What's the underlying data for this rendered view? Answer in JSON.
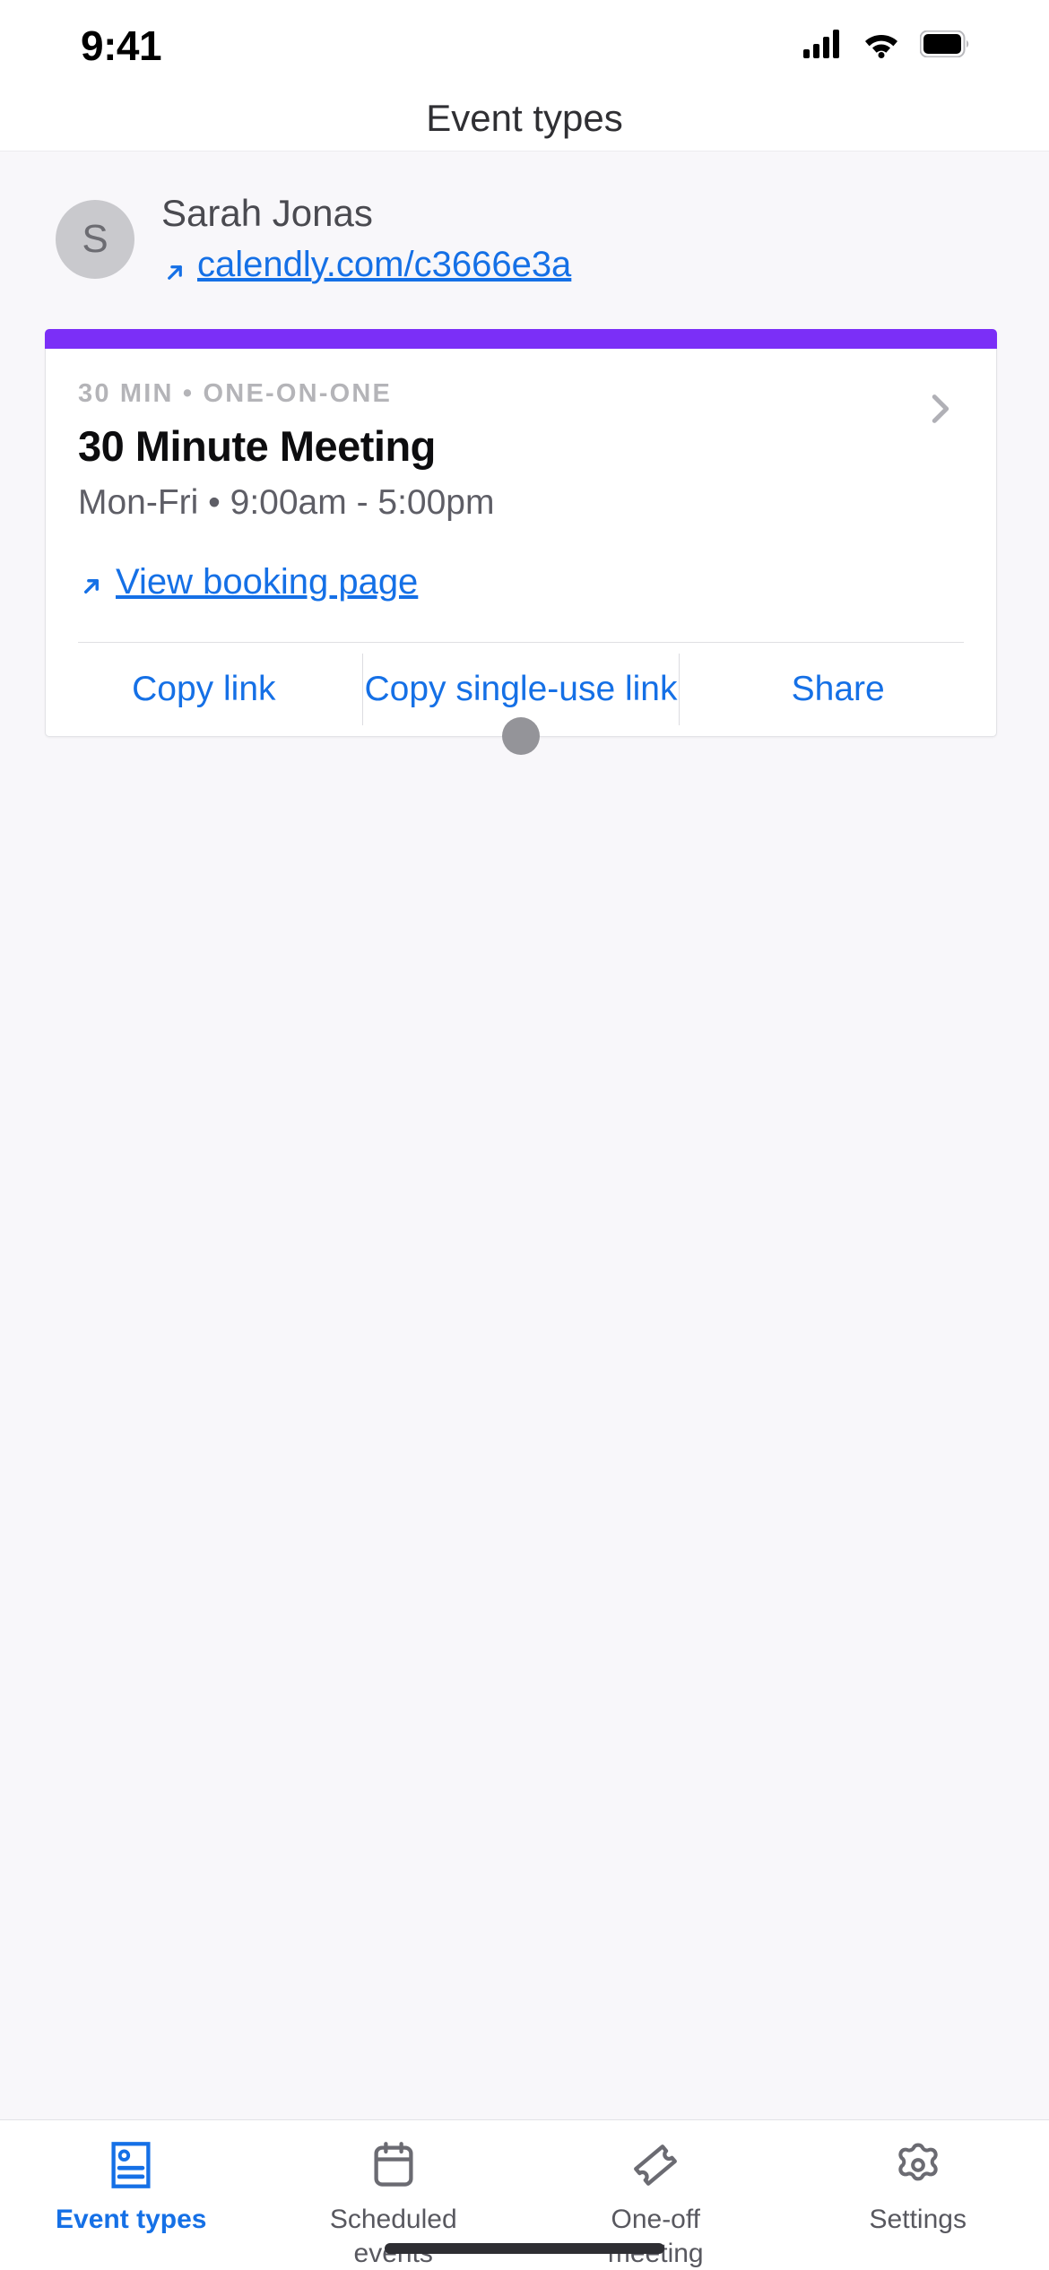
{
  "status_bar": {
    "time": "9:41",
    "icons": [
      "cellular-signal-icon",
      "wifi-icon",
      "battery-icon"
    ]
  },
  "header": {
    "title": "Event types"
  },
  "profile": {
    "avatar_initial": "S",
    "name": "Sarah Jonas",
    "link_text": "calendly.com/c3666e3a",
    "link_icon": "external-link-icon"
  },
  "event_card": {
    "accent_color": "#7b2ff7",
    "meta": "30 MIN • ONE-ON-ONE",
    "title": "30 Minute Meeting",
    "schedule": "Mon-Fri • 9:00am - 5:00pm",
    "booking_link": "View booking page",
    "booking_link_icon": "external-link-icon",
    "chevron_icon": "chevron-right-icon",
    "drag_handle_icon": "drag-handle-dot",
    "actions": [
      {
        "label": "Copy link"
      },
      {
        "label": "Copy single-use link"
      },
      {
        "label": "Share"
      }
    ]
  },
  "tab_bar": {
    "active_color": "#1570e6",
    "inactive_color": "#58585f",
    "tabs": [
      {
        "label": "Event types",
        "icon": "contact-card-icon",
        "active": true
      },
      {
        "label": "Scheduled events",
        "icon": "calendar-icon",
        "active": false
      },
      {
        "label": "One-off meeting",
        "icon": "ticket-icon",
        "active": false
      },
      {
        "label": "Settings",
        "icon": "gear-icon",
        "active": false
      }
    ]
  }
}
